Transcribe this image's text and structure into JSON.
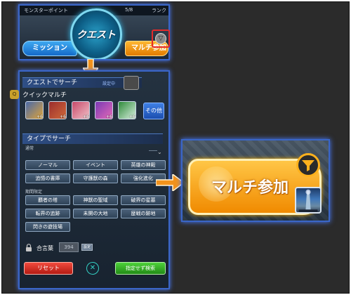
{
  "topbar": {
    "stat_left": "モンスターポイント",
    "stat_right": "5/8",
    "stat_far": "ランク",
    "quest_label": "クエスト",
    "mission_label": "ミッション",
    "multi_label": "マルチ参加"
  },
  "panel": {
    "quest_search_header": "クエストでサーチ",
    "setting_tag": "設定中",
    "quick_multi_icon": "Q",
    "quick_multi_label": "クイックマルチ",
    "characters": [
      {
        "name": "character-1",
        "plus": "+6",
        "color_a": "#4a6aa8",
        "color_b": "#e0a43a"
      },
      {
        "name": "character-2",
        "plus": "+6",
        "color_a": "#9b2d2d",
        "color_b": "#d06a3a"
      },
      {
        "name": "character-3",
        "plus": "+6",
        "color_a": "#c84a6a",
        "color_b": "#f0c0c8"
      },
      {
        "name": "character-4",
        "plus": "+6",
        "color_a": "#7a3ab4",
        "color_b": "#e46ab8"
      },
      {
        "name": "character-5",
        "plus": "+6",
        "color_a": "#2f8a3a",
        "color_b": "#d8f0e0"
      }
    ],
    "other_button": "その他",
    "type_search_header": "タイプでサーチ",
    "normal_label": "通常",
    "limited_label": "期間限定",
    "type_buttons_normal": [
      "ノーマル",
      "イベント",
      "英雄の神殿",
      "追憶の書庫",
      "守護獣の森",
      "強化進化"
    ],
    "type_buttons_limited": [
      "覇者の塔",
      "神獣の聖域",
      "破界の星墓",
      "転界の追跡",
      "未開の大地",
      "歴戦の跡地",
      "閃きの遊技場"
    ],
    "password_label": "合言葉",
    "password_value": "394",
    "password_set": "設定",
    "reset_label": "リセット",
    "close_symbol": "✕",
    "search_label": "指定せず検索"
  },
  "zoom": {
    "multi_label": "マルチ参加"
  },
  "icons": {
    "filter": "filter-icon",
    "lock": "lock-icon",
    "arrow": "arrow-icon"
  },
  "colors": {
    "accent_blue": "#3a66c8",
    "orange": "#f08a00",
    "highlight_red": "#e52a2a"
  }
}
